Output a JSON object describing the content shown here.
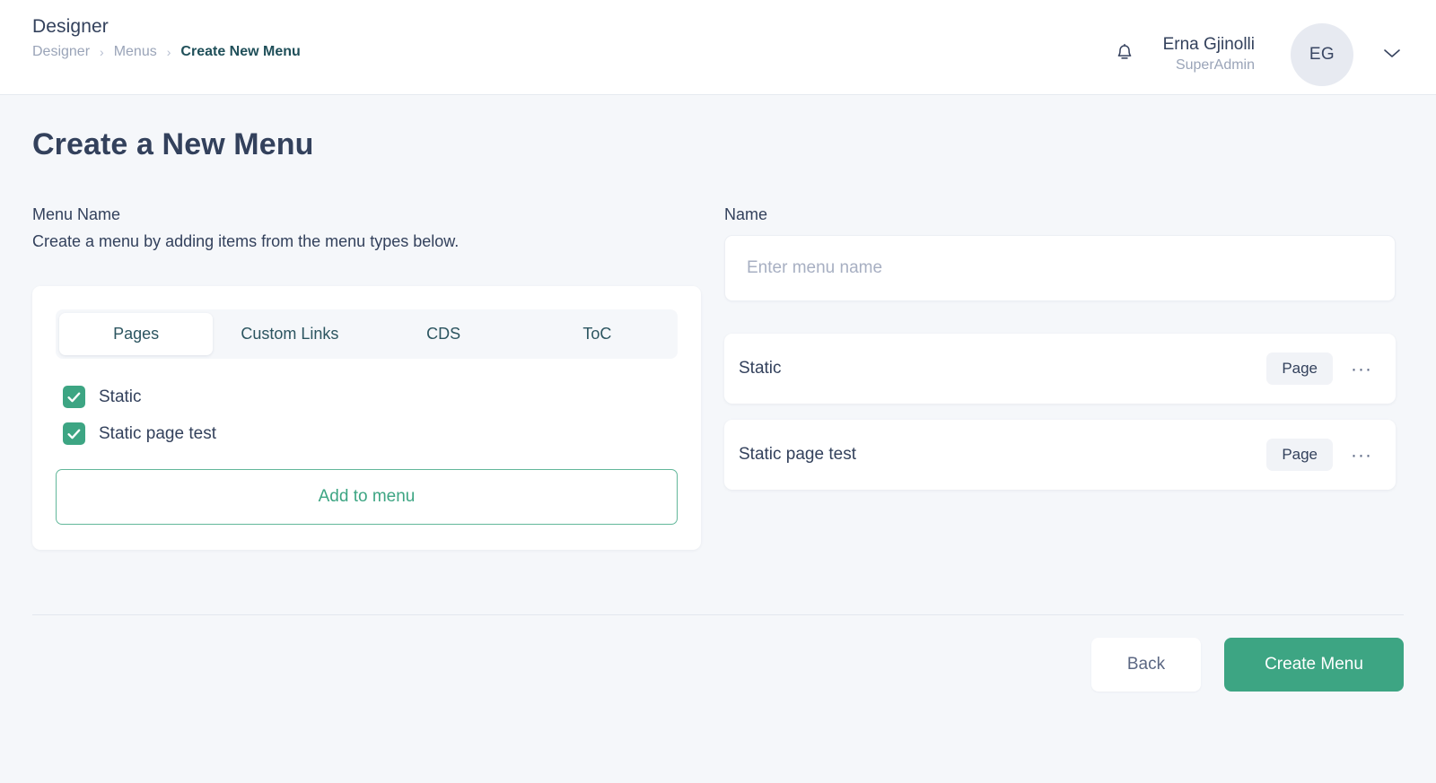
{
  "header": {
    "brand_title": "Designer",
    "breadcrumb": [
      {
        "label": "Designer",
        "current": false
      },
      {
        "label": "Menus",
        "current": false
      },
      {
        "label": "Create New Menu",
        "current": true
      }
    ],
    "separator": "›",
    "bell_icon": "bell-icon",
    "user": {
      "name": "Erna Gjinolli",
      "role": "SuperAdmin",
      "initials": "EG"
    },
    "caret_icon": "chevron-down-icon"
  },
  "page": {
    "title": "Create a New Menu"
  },
  "left": {
    "section_label": "Menu Name",
    "section_desc": "Create a menu by adding items from the menu types below.",
    "tabs": [
      {
        "label": "Pages",
        "active": true
      },
      {
        "label": "Custom Links",
        "active": false
      },
      {
        "label": "CDS",
        "active": false
      },
      {
        "label": "ToC",
        "active": false
      }
    ],
    "checkboxes": [
      {
        "label": "Static",
        "checked": true
      },
      {
        "label": "Static page test",
        "checked": true
      }
    ],
    "add_button": "Add to menu"
  },
  "right": {
    "name_label": "Name",
    "name_value": "",
    "name_placeholder": "Enter menu name",
    "items": [
      {
        "name": "Static",
        "badge": "Page",
        "more": "···"
      },
      {
        "name": "Static page test",
        "badge": "Page",
        "more": "···"
      }
    ]
  },
  "footer": {
    "back_label": "Back",
    "create_label": "Create Menu"
  },
  "colors": {
    "accent_green": "#3da583",
    "page_background": "#f5f7fa",
    "text_primary": "#33415c",
    "text_muted": "#9aa4b8",
    "breadcrumb_active": "#1f4f59"
  }
}
